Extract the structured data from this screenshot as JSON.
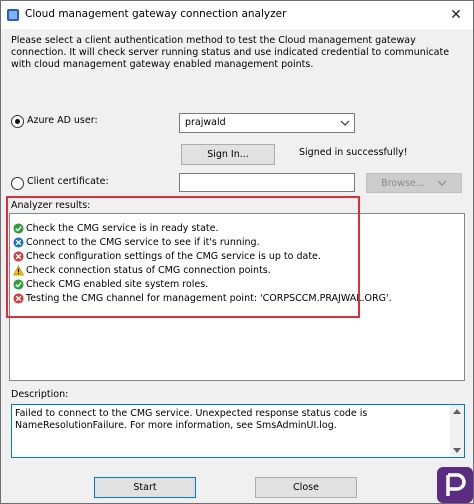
{
  "window": {
    "title": "Cloud management gateway connection analyzer",
    "close_glyph": "✕",
    "icon": "app-icon"
  },
  "intro": "Please select a client authentication method to test the Cloud management gateway connection. It will check server running status and use indicated credential to communicate with cloud management gateway enabled management points.",
  "auth": {
    "azure_label": "Azure AD user:",
    "azure_user": "prajwald",
    "sign_in_label": "Sign In...",
    "signed_in_status": "Signed in successfully!",
    "client_cert_label": "Client certificate:",
    "client_cert_value": "",
    "browse_label": "Browse..."
  },
  "results": {
    "label": "Analyzer results:",
    "items": [
      {
        "status": "success",
        "text": "Check the CMG service is in ready state."
      },
      {
        "status": "info",
        "text": "Connect to the CMG service to see if it's running."
      },
      {
        "status": "error",
        "text": "Check configuration settings of the CMG service is up to date."
      },
      {
        "status": "warning",
        "text": "Check connection status of CMG connection points."
      },
      {
        "status": "success",
        "text": "Check CMG enabled site system roles."
      },
      {
        "status": "error",
        "text": "Testing the CMG channel for management point: 'CORPSCCM.PRAJWAL.ORG'."
      }
    ]
  },
  "description": {
    "label": "Description:",
    "text": "Failed to connect to the CMG service. Unexpected response status code is NameResolutionFailure. For more information, see SmsAdminUI.log."
  },
  "footer": {
    "start_label": "Start",
    "close_label": "Close"
  },
  "colors": {
    "success": "#2e9e3a",
    "info": "#1f6fd1",
    "error": "#d83b3b",
    "warning": "#f2c200",
    "highlight": "#d9303e",
    "logo": "#5a2d82"
  }
}
